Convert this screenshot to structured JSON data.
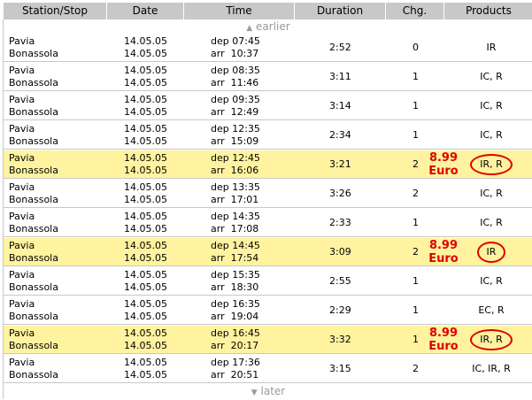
{
  "table": {
    "columns": [
      "Station/Stop",
      "Date",
      "Time",
      "Duration",
      "Chg.",
      "Products"
    ],
    "earlier_label": "earlier",
    "later_label": "later",
    "dep_prefix": "dep",
    "arr_prefix": "arr",
    "rows": [
      {
        "from": "Pavia",
        "to": "Bonassola",
        "date_dep": "14.05.05",
        "date_arr": "14.05.05",
        "dep": "07:45",
        "arr": "10:37",
        "duration": "2:52",
        "changes": "0",
        "products": "IR",
        "highlight": false,
        "price": "",
        "currency": ""
      },
      {
        "from": "Pavia",
        "to": "Bonassola",
        "date_dep": "14.05.05",
        "date_arr": "14.05.05",
        "dep": "08:35",
        "arr": "11:46",
        "duration": "3:11",
        "changes": "1",
        "products": "IC, R",
        "highlight": false,
        "price": "",
        "currency": ""
      },
      {
        "from": "Pavia",
        "to": "Bonassola",
        "date_dep": "14.05.05",
        "date_arr": "14.05.05",
        "dep": "09:35",
        "arr": "12:49",
        "duration": "3:14",
        "changes": "1",
        "products": "IC, R",
        "highlight": false,
        "price": "",
        "currency": ""
      },
      {
        "from": "Pavia",
        "to": "Bonassola",
        "date_dep": "14.05.05",
        "date_arr": "14.05.05",
        "dep": "12:35",
        "arr": "15:09",
        "duration": "2:34",
        "changes": "1",
        "products": "IC, R",
        "highlight": false,
        "price": "",
        "currency": ""
      },
      {
        "from": "Pavia",
        "to": "Bonassola",
        "date_dep": "14.05.05",
        "date_arr": "14.05.05",
        "dep": "12:45",
        "arr": "16:06",
        "duration": "3:21",
        "changes": "2",
        "products": "IR, R",
        "highlight": true,
        "price": "8.99",
        "currency": "Euro"
      },
      {
        "from": "Pavia",
        "to": "Bonassola",
        "date_dep": "14.05.05",
        "date_arr": "14.05.05",
        "dep": "13:35",
        "arr": "17:01",
        "duration": "3:26",
        "changes": "2",
        "products": "IC, R",
        "highlight": false,
        "price": "",
        "currency": ""
      },
      {
        "from": "Pavia",
        "to": "Bonassola",
        "date_dep": "14.05.05",
        "date_arr": "14.05.05",
        "dep": "14:35",
        "arr": "17:08",
        "duration": "2:33",
        "changes": "1",
        "products": "IC, R",
        "highlight": false,
        "price": "",
        "currency": ""
      },
      {
        "from": "Pavia",
        "to": "Bonassola",
        "date_dep": "14.05.05",
        "date_arr": "14.05.05",
        "dep": "14:45",
        "arr": "17:54",
        "duration": "3:09",
        "changes": "2",
        "products": "IR",
        "highlight": true,
        "price": "8.99",
        "currency": "Euro"
      },
      {
        "from": "Pavia",
        "to": "Bonassola",
        "date_dep": "14.05.05",
        "date_arr": "14.05.05",
        "dep": "15:35",
        "arr": "18:30",
        "duration": "2:55",
        "changes": "1",
        "products": "IC, R",
        "highlight": false,
        "price": "",
        "currency": ""
      },
      {
        "from": "Pavia",
        "to": "Bonassola",
        "date_dep": "14.05.05",
        "date_arr": "14.05.05",
        "dep": "16:35",
        "arr": "19:04",
        "duration": "2:29",
        "changes": "1",
        "products": "EC, R",
        "highlight": false,
        "price": "",
        "currency": ""
      },
      {
        "from": "Pavia",
        "to": "Bonassola",
        "date_dep": "14.05.05",
        "date_arr": "14.05.05",
        "dep": "16:45",
        "arr": "20:17",
        "duration": "3:32",
        "changes": "1",
        "products": "IR, R",
        "highlight": true,
        "price": "8.99",
        "currency": "Euro"
      },
      {
        "from": "Pavia",
        "to": "Bonassola",
        "date_dep": "14.05.05",
        "date_arr": "14.05.05",
        "dep": "17:36",
        "arr": "20:51",
        "duration": "3:15",
        "changes": "2",
        "products": "IC, IR, R",
        "highlight": false,
        "price": "",
        "currency": ""
      }
    ]
  },
  "colors": {
    "header_bg": "#c8c8c8",
    "highlight_bg": "#fff3a0",
    "price": "#dd0000",
    "nav_text": "#9a9a9a",
    "divider": "#c8c8c8"
  },
  "icons": {
    "earlier": "triangle-up-icon",
    "later": "triangle-down-icon"
  }
}
